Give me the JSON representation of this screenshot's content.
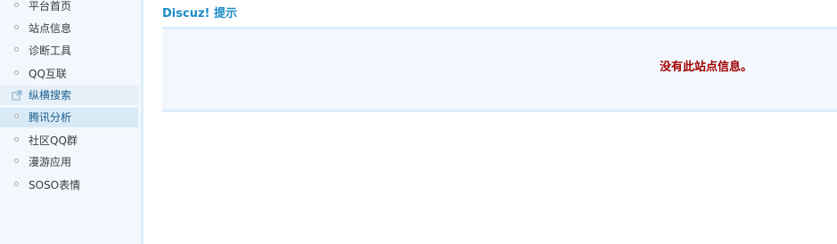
{
  "sidebar": {
    "items": [
      {
        "label": "平台首页",
        "icon": "bullet-icon"
      },
      {
        "label": "站点信息",
        "icon": "bullet-icon"
      },
      {
        "label": "诊断工具",
        "icon": "bullet-icon"
      },
      {
        "label": "QQ互联",
        "icon": "bullet-icon"
      },
      {
        "label": "纵横搜索",
        "icon": "external-link-icon"
      },
      {
        "label": "腾讯分析",
        "icon": "bullet-icon"
      },
      {
        "label": "社区QQ群",
        "icon": "bullet-icon"
      },
      {
        "label": "漫游应用",
        "icon": "bullet-icon"
      },
      {
        "label": "SOSO表情",
        "icon": "bullet-icon"
      }
    ]
  },
  "main": {
    "title": "Discuz! 提示",
    "message": "没有此站点信息。"
  },
  "colors": {
    "sidebar_bg": "#f2f8fd",
    "title": "#1c8bc6",
    "message": "#a10000",
    "active_item": "#d9eaf7",
    "hover_item": "#e6f0f8"
  }
}
